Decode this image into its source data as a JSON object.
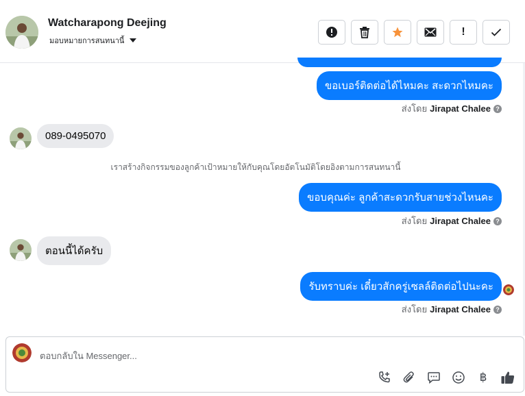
{
  "header": {
    "contact_name": "Watcharapong Deejing",
    "assign_label": "มอบหมายการสนทนานี้",
    "actions": [
      {
        "icon": "report-icon",
        "glyph": "!"
      },
      {
        "icon": "trash-icon",
        "glyph": ""
      },
      {
        "icon": "star-icon",
        "glyph": "★"
      },
      {
        "icon": "envelope-icon",
        "glyph": ""
      },
      {
        "icon": "exclamation-icon",
        "glyph": "!"
      },
      {
        "icon": "checkmark-icon",
        "glyph": "✓"
      }
    ]
  },
  "messages": {
    "m1": "ขอเบอร์ติดต่อได้ไหมคะ สะดวกไหมคะ",
    "m2": "089-0495070",
    "m3": "ขอบคุณค่ะ ลูกค้าสะดวกรับสายช่วงไหนคะ",
    "m4": "ตอนนี้ได้ครับ",
    "m5": "รับทราบค่ะ เดี๋ยวสักครู่เซลล์ติดต่อไปนะคะ"
  },
  "sent_by": {
    "prefix": "ส่งโดย",
    "agent": "Jirapat Chalee",
    "help": "?"
  },
  "system_note": "เราสร้างกิจกรรมของลูกค้าเป้าหมายให้กับคุณโดยอัตโนมัติโดยอิงตามการสนทนานี้",
  "composer": {
    "placeholder": "ตอบกลับใน Messenger...",
    "tools": [
      "add-call-icon",
      "paperclip-icon",
      "saved-reply-icon",
      "emoji-icon",
      "baht-icon",
      "thumbs-up-icon"
    ],
    "baht_glyph": "฿"
  },
  "colors": {
    "outgoing_bubble": "#0a7cff",
    "incoming_bubble": "#e9eaed",
    "star": "#f7923a"
  }
}
